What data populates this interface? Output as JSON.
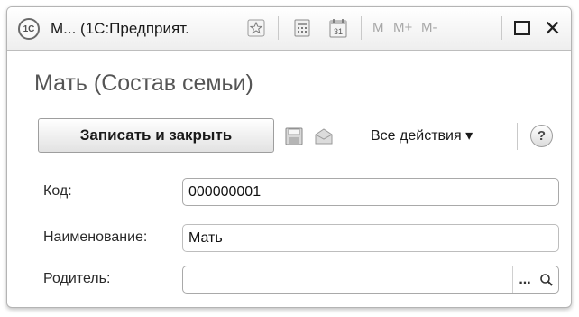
{
  "window": {
    "title": "М...  (1С:Предприят.",
    "logo_text": "1С",
    "toolbar": {
      "favorite_icon": "star-icon",
      "calculator_icon": "calculator-icon",
      "calendar_icon": "calendar-icon",
      "calendar_day": "31",
      "memory_m": "M",
      "memory_plus": "M+",
      "memory_minus": "M-",
      "maximize_icon": "maximize-icon",
      "close_icon": "close-icon",
      "close_glyph": "✕"
    }
  },
  "form": {
    "title": "Мать (Состав семьи)",
    "commands": {
      "save_close_label": "Записать и закрыть",
      "save_icon": "floppy-disk-icon",
      "envelope_icon": "envelope-icon",
      "all_actions_label": "Все действия ▾",
      "help_label": "?"
    },
    "fields": [
      {
        "label": "Код:",
        "value": ""
      },
      {
        "label": "Наименование:",
        "value": "Мать"
      },
      {
        "label": "Родитель:",
        "value": ""
      }
    ],
    "code_value": "000000001",
    "parent_select_label": "...",
    "search_icon": "magnifier-icon"
  },
  "colors": {
    "title_gray": "#555555",
    "border": "#a9a9a9"
  }
}
